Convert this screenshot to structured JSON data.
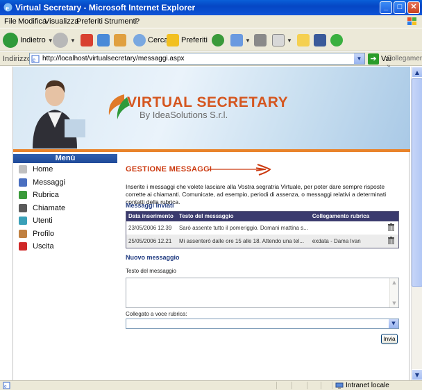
{
  "window": {
    "title": "Virtual Secretary - Microsoft Internet Explorer",
    "minimize": "_",
    "maximize": "□",
    "close": "✕"
  },
  "menubar": [
    "File",
    "Modifica",
    "Visualizza",
    "Preferiti",
    "Strumenti",
    "?"
  ],
  "toolbar": {
    "back_label": "Indietro",
    "search_label": "Cerca",
    "favorites_label": "Preferiti"
  },
  "address": {
    "label": "Indirizzo",
    "url": "http://localhost/virtualsecretary/messaggi.aspx",
    "go_label": "Vai",
    "links_label": "Collegamenti »"
  },
  "banner": {
    "title": "VIRTUAL SECRETARY",
    "subtitle": "By IdeaSolutions S.r.l."
  },
  "menu": {
    "header": "Menù",
    "items": [
      {
        "label": "Home",
        "icon": "home-icon",
        "color": "#c0c0c0"
      },
      {
        "label": "Messaggi",
        "icon": "messages-icon",
        "color": "#4a6fc0"
      },
      {
        "label": "Rubrica",
        "icon": "addressbook-icon",
        "color": "#3a9a3a"
      },
      {
        "label": "Chiamate",
        "icon": "phone-icon",
        "color": "#5a5a5a"
      },
      {
        "label": "Utenti",
        "icon": "users-icon",
        "color": "#3aa0b8"
      },
      {
        "label": "Profilo",
        "icon": "profile-icon",
        "color": "#c08040"
      },
      {
        "label": "Uscita",
        "icon": "exit-icon",
        "color": "#d02828"
      }
    ]
  },
  "content": {
    "title": "GESTIONE MESSAGGI",
    "intro": "Inserite i messaggi che volete lasciare alla Vostra segratria Virtuale, per poter dare sempre risposte corrette ai chiamanti. Comunicate, ad esempio, periodi di assenza, o messaggi relativi a determinati contatti della rubrica.",
    "sent_heading": "Messaggi inviati",
    "table": {
      "headers": [
        "Data inserimento",
        "Testo del messaggio",
        "Collegamento rubrica",
        ""
      ],
      "rows": [
        {
          "date": "23/05/2006 12.39",
          "text": "Sarò assente tutto il pomeriggio. Domani mattina s...",
          "link": ""
        },
        {
          "date": "25/05/2006 12.21",
          "text": "Mi assenterò dalle ore 15 alle 18. Attendo una tel...",
          "link": "exdata - Dama Ivan"
        }
      ]
    },
    "new_heading": "Nuovo messaggio",
    "text_label": "Testo del messaggio",
    "link_label": "Collegato a voce rubrica:",
    "select_value": "",
    "send_label": "Invia"
  },
  "statusbar": {
    "zone": "Intranet locale"
  }
}
